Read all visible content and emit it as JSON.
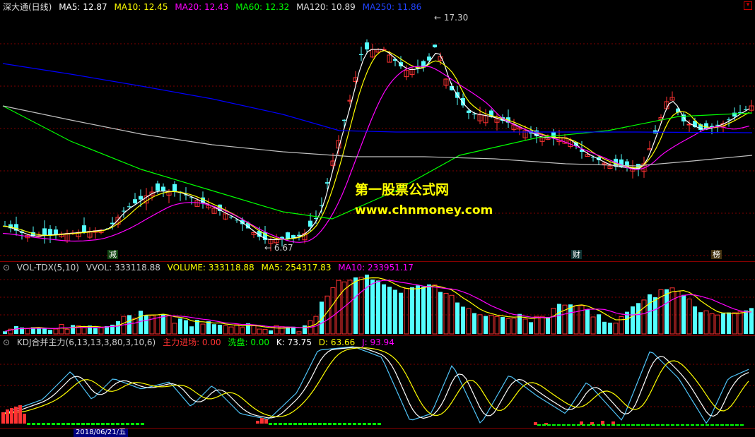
{
  "colors": {
    "up": "#ff3232",
    "down": "#54ffff",
    "ma5": "#ffffff",
    "ma10": "#ffff00",
    "ma20": "#ff00ff",
    "ma60": "#00ff00",
    "ma120": "#c0c0c0",
    "ma250": "#0000ff",
    "grid": "#800000"
  },
  "header": {
    "title": "深大通(日线)",
    "ma5": "MA5: 12.87",
    "ma10": "MA10: 12.45",
    "ma20": "MA20: 12.43",
    "ma60": "MA60: 12.32",
    "ma120": "MA120: 10.89",
    "ma250": "MA250: 11.86"
  },
  "price": {
    "high_label": "17.30",
    "low_label": "6.67",
    "tags": [
      "减",
      "财",
      "榜"
    ]
  },
  "watermark": {
    "line1": "第一股票公式网",
    "line2": "www.chnmoney.com"
  },
  "volume": {
    "title": "VOL-TDX(5,10)",
    "vvol": "VVOL: 333118.88",
    "volume": "VOLUME: 333118.88",
    "ma5": "MA5: 254317.83",
    "ma10": "MA10: 233951.17"
  },
  "kdj": {
    "title": "KDJ合并主力(6,13,13,3,80,3,10,6)",
    "main": "主力进场: 0.00",
    "wash": "洗盘: 0.00",
    "k": "K: 73.75",
    "d": "D: 63.66",
    "j": "J: 93.94"
  },
  "axis": {
    "date_label": "2018/06/21/五"
  },
  "chart_data": {
    "type": "candlestick",
    "series": [
      {
        "name": "MA5",
        "values": [
          12.87
        ]
      },
      {
        "name": "MA10",
        "values": [
          12.45
        ]
      },
      {
        "name": "MA20",
        "values": [
          12.43
        ]
      },
      {
        "name": "MA60",
        "values": [
          12.32
        ]
      },
      {
        "name": "MA120",
        "values": [
          10.89
        ]
      },
      {
        "name": "MA250",
        "values": [
          11.86
        ]
      }
    ],
    "annotations": [
      {
        "label": "17.30",
        "kind": "high"
      },
      {
        "label": "6.67",
        "kind": "low"
      }
    ]
  }
}
